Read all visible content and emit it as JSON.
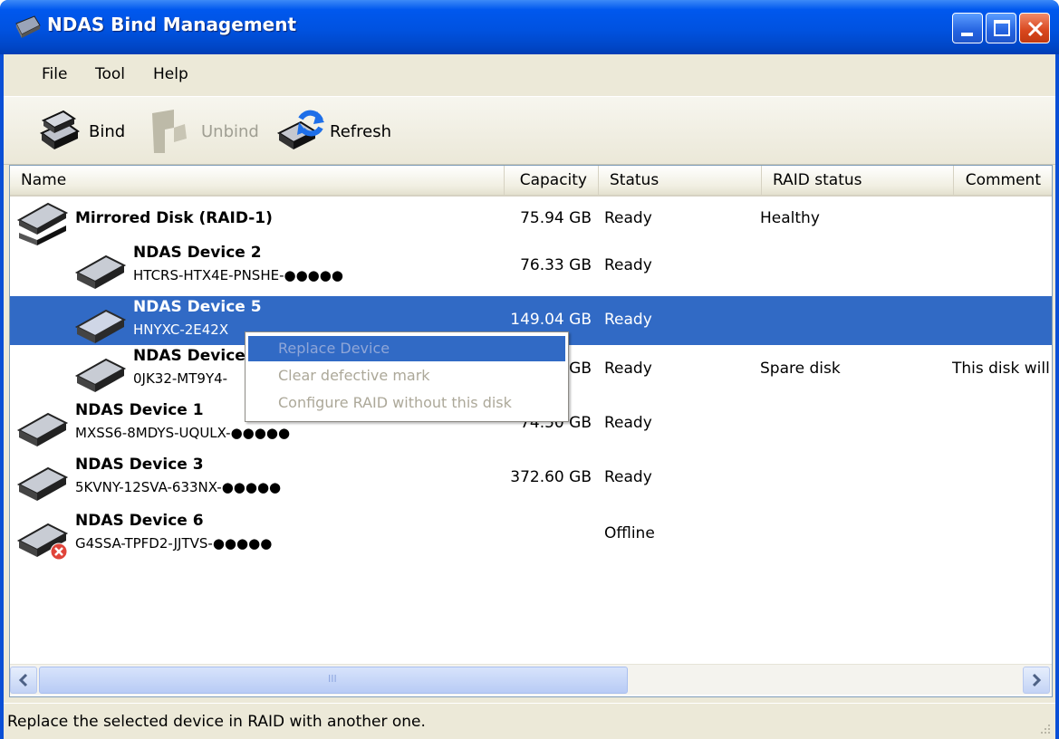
{
  "window": {
    "title": "NDAS Bind Management"
  },
  "menu": [
    "File",
    "Tool",
    "Help"
  ],
  "toolbar": {
    "bind_label": "Bind",
    "unbind_label": "Unbind",
    "refresh_label": "Refresh"
  },
  "columns": {
    "name": "Name",
    "capacity": "Capacity",
    "status": "Status",
    "raid_status": "RAID status",
    "comment": "Comment"
  },
  "rows": [
    {
      "name": "Mirrored Disk (RAID-1)",
      "serial": "",
      "capacity": "75.94 GB",
      "status": "Ready",
      "raid_status": "Healthy",
      "comment": "",
      "level": 0,
      "icon": "raid-disk-icon"
    },
    {
      "name": "NDAS Device 2",
      "serial": "HTCRS-HTX4E-PNSHE-●●●●●",
      "capacity": "76.33 GB",
      "status": "Ready",
      "raid_status": "",
      "comment": "",
      "level": 1,
      "icon": "disk-icon"
    },
    {
      "name": "NDAS Device 5",
      "serial": "HNYXC-2E42X",
      "capacity": "149.04 GB",
      "status": "Ready",
      "raid_status": "",
      "comment": "",
      "level": 1,
      "icon": "disk-icon",
      "selected": true
    },
    {
      "name": "NDAS Device",
      "serial": "0JK32-MT9Y4-",
      "capacity": "GB",
      "status": "Ready",
      "raid_status": "Spare disk",
      "comment": "This disk will",
      "level": 1,
      "icon": "disk-icon"
    },
    {
      "name": "NDAS Device 1",
      "serial": "MXSS6-8MDYS-UQULX-●●●●●",
      "capacity": "74.50 GB",
      "status": "Ready",
      "raid_status": "",
      "comment": "",
      "level": 0,
      "icon": "disk-icon"
    },
    {
      "name": "NDAS Device 3",
      "serial": "5KVNY-12SVA-633NX-●●●●●",
      "capacity": "372.60 GB",
      "status": "Ready",
      "raid_status": "",
      "comment": "",
      "level": 0,
      "icon": "disk-icon"
    },
    {
      "name": "NDAS Device 6",
      "serial": "G4SSA-TPFD2-JJTVS-●●●●●",
      "capacity": "",
      "status": "Offline",
      "raid_status": "",
      "comment": "",
      "level": 0,
      "icon": "offline-disk-icon"
    }
  ],
  "context_menu": [
    "Replace Device",
    "Clear defective mark",
    "Configure RAID without this disk"
  ],
  "scrollbar": {
    "thumb_grip": "III"
  },
  "statusbar": {
    "text": "Replace the selected device in RAID with another one."
  }
}
